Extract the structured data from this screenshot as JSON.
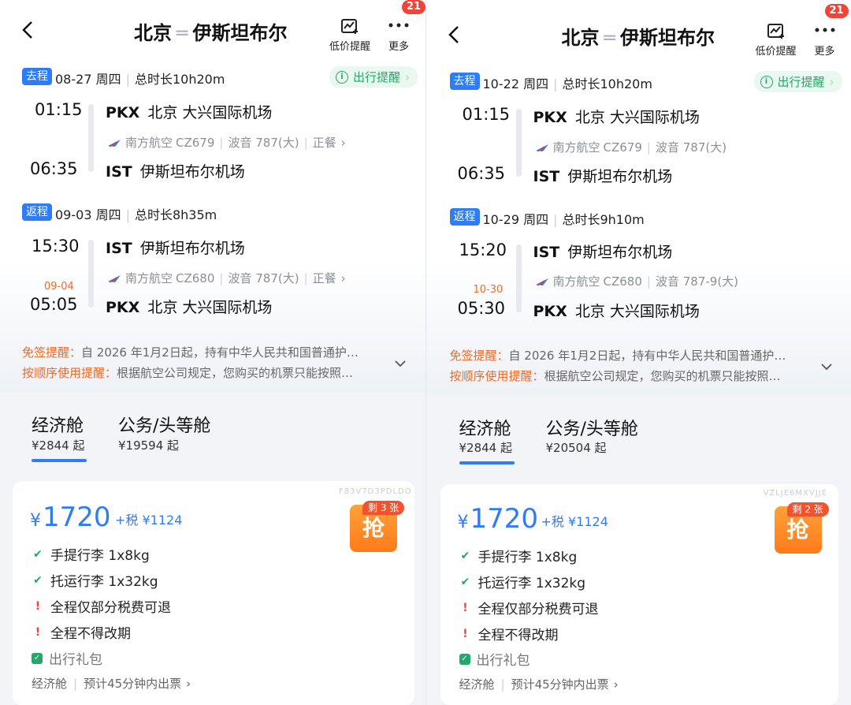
{
  "header": {
    "back_icon": "chevron-left-icon",
    "from": "北京",
    "to": "伊斯坦布尔",
    "price_alert_label": "低价提醒",
    "more_label": "更多",
    "badge_count": "21"
  },
  "trip_reminder_label": "出行提醒",
  "notices": {
    "visa_key": "免签提醒：",
    "visa_text": "自 2026 年1月2日起，持有中华人民共和国普通护…",
    "order_key": "按顺序使用提醒：",
    "order_text": "根据航空公司规定，您购买的机票只能按照…"
  },
  "panels": [
    {
      "outbound": {
        "tag": "去程",
        "date": "08-27 周四",
        "duration": "总时长10h20m",
        "dep_time": "01:15",
        "dep_code": "PKX",
        "dep_airport": "北京 大兴国际机场",
        "airline": "南方航空",
        "flight_no": "CZ679",
        "aircraft": "波音 787(大)",
        "meal": "正餐",
        "arr_time": "06:35",
        "arr_code": "IST",
        "arr_airport": "伊斯坦布尔机场"
      },
      "return": {
        "tag": "返程",
        "date": "09-03 周四",
        "duration": "总时长8h35m",
        "dep_time": "15:30",
        "dep_code": "IST",
        "dep_airport": "伊斯坦布尔机场",
        "airline": "南方航空",
        "flight_no": "CZ680",
        "aircraft": "波音 787(大)",
        "meal": "正餐",
        "arr_date": "09-04",
        "arr_time": "05:05",
        "arr_code": "PKX",
        "arr_airport": "北京 大兴国际机场"
      },
      "cabins": {
        "economy_label": "经济舱",
        "economy_price": "¥2844 起",
        "business_label": "公务/头等舱",
        "business_price": "¥19594 起"
      },
      "offer": {
        "code": "F83V7D3PDLDO",
        "currency": "¥",
        "price": "1720",
        "tax": "+税 ¥1124",
        "remaining": "剩 3 张",
        "grab": "抢",
        "features": [
          "手提行李 1x8kg",
          "托运行李 1x32kg",
          "全程仅部分税费可退",
          "全程不得改期"
        ],
        "gift": "出行礼包",
        "cabin": "经济舱",
        "ticketing": "预计45分钟内出票"
      }
    },
    {
      "outbound": {
        "tag": "去程",
        "date": "10-22 周四",
        "duration": "总时长10h20m",
        "dep_time": "01:15",
        "dep_code": "PKX",
        "dep_airport": "北京 大兴国际机场",
        "airline": "南方航空",
        "flight_no": "CZ679",
        "aircraft": "波音 787(大)",
        "meal": "",
        "arr_time": "06:35",
        "arr_code": "IST",
        "arr_airport": "伊斯坦布尔机场"
      },
      "return": {
        "tag": "返程",
        "date": "10-29 周四",
        "duration": "总时长9h10m",
        "dep_time": "15:20",
        "dep_code": "IST",
        "dep_airport": "伊斯坦布尔机场",
        "airline": "南方航空",
        "flight_no": "CZ680",
        "aircraft": "波音 787-9(大)",
        "meal": "",
        "arr_date": "10-30",
        "arr_time": "05:30",
        "arr_code": "PKX",
        "arr_airport": "北京 大兴国际机场"
      },
      "cabins": {
        "economy_label": "经济舱",
        "economy_price": "¥2844 起",
        "business_label": "公务/头等舱",
        "business_price": "¥20504 起"
      },
      "offer": {
        "code": "VZLJE6MXVJJE",
        "currency": "¥",
        "price": "1720",
        "tax": "+税 ¥1124",
        "remaining": "剩 2 张",
        "grab": "抢",
        "features": [
          "手提行李 1x8kg",
          "托运行李 1x32kg",
          "全程仅部分税费可退",
          "全程不得改期"
        ],
        "gift": "出行礼包",
        "cabin": "经济舱",
        "ticketing": "预计45分钟内出票"
      }
    }
  ],
  "colors": {
    "accent": "#2e7cf6",
    "orange": "#ef6b28",
    "green": "#22a869",
    "red": "#f04438"
  }
}
